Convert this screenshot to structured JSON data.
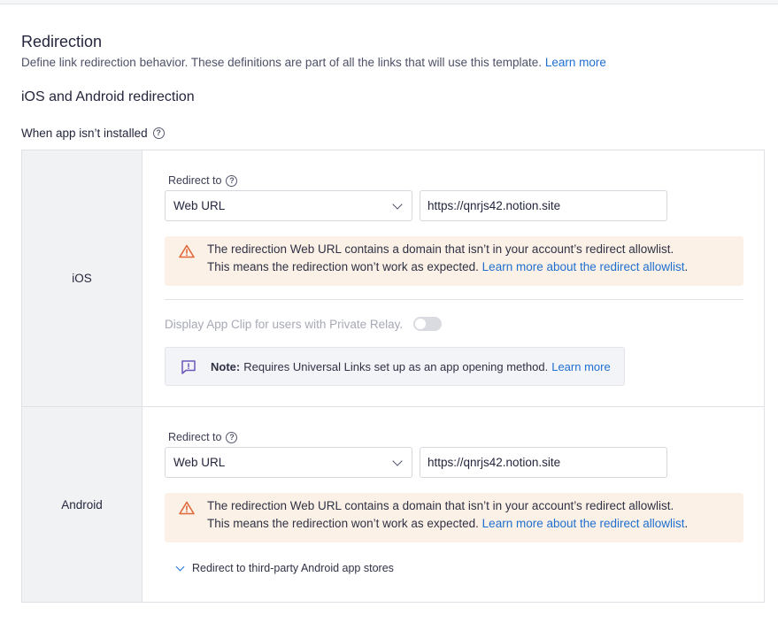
{
  "section": {
    "title": "Redirection",
    "description": "Define link redirection behavior. These definitions are part of all the links that will use this template.",
    "learn_more": "Learn more"
  },
  "ios_android": {
    "heading": "iOS and Android redirection",
    "subheading": "When app isn’t installed"
  },
  "ios": {
    "platform_label": "iOS",
    "redirect_label": "Redirect to",
    "redirect_select_value": "Web URL",
    "redirect_url_value": "https://qnrjs42.notion.site",
    "warning_line1": "The redirection Web URL contains a domain that isn’t in your account’s redirect allowlist.",
    "warning_line2": "This means the redirection won’t work as expected.",
    "warning_link": "Learn more about the redirect allowlist",
    "warning_period": ".",
    "app_clip_label": "Display App Clip for users with Private Relay.",
    "app_clip_enabled": false,
    "note_label": "Note:",
    "note_text": "Requires Universal Links set up as an app opening method.",
    "note_link": "Learn more"
  },
  "android": {
    "platform_label": "Android",
    "redirect_label": "Redirect to",
    "redirect_select_value": "Web URL",
    "redirect_url_value": "https://qnrjs42.notion.site",
    "warning_line1": "The redirection Web URL contains a domain that isn’t in your account’s redirect allowlist.",
    "warning_line2": "This means the redirection won’t work as expected.",
    "warning_link": "Learn more about the redirect allowlist",
    "warning_period": ".",
    "third_party_stores": "Redirect to third-party Android app stores"
  },
  "icons": {
    "help": "question-circle-icon",
    "warning": "warning-triangle-icon",
    "note": "message-exclamation-icon",
    "dropdown": "chevron-down-icon"
  },
  "colors": {
    "link": "#1f6fd1",
    "warning_bg": "#fbf1e6",
    "warning_icon": "#e0683a",
    "note_icon": "#6a57b8"
  }
}
